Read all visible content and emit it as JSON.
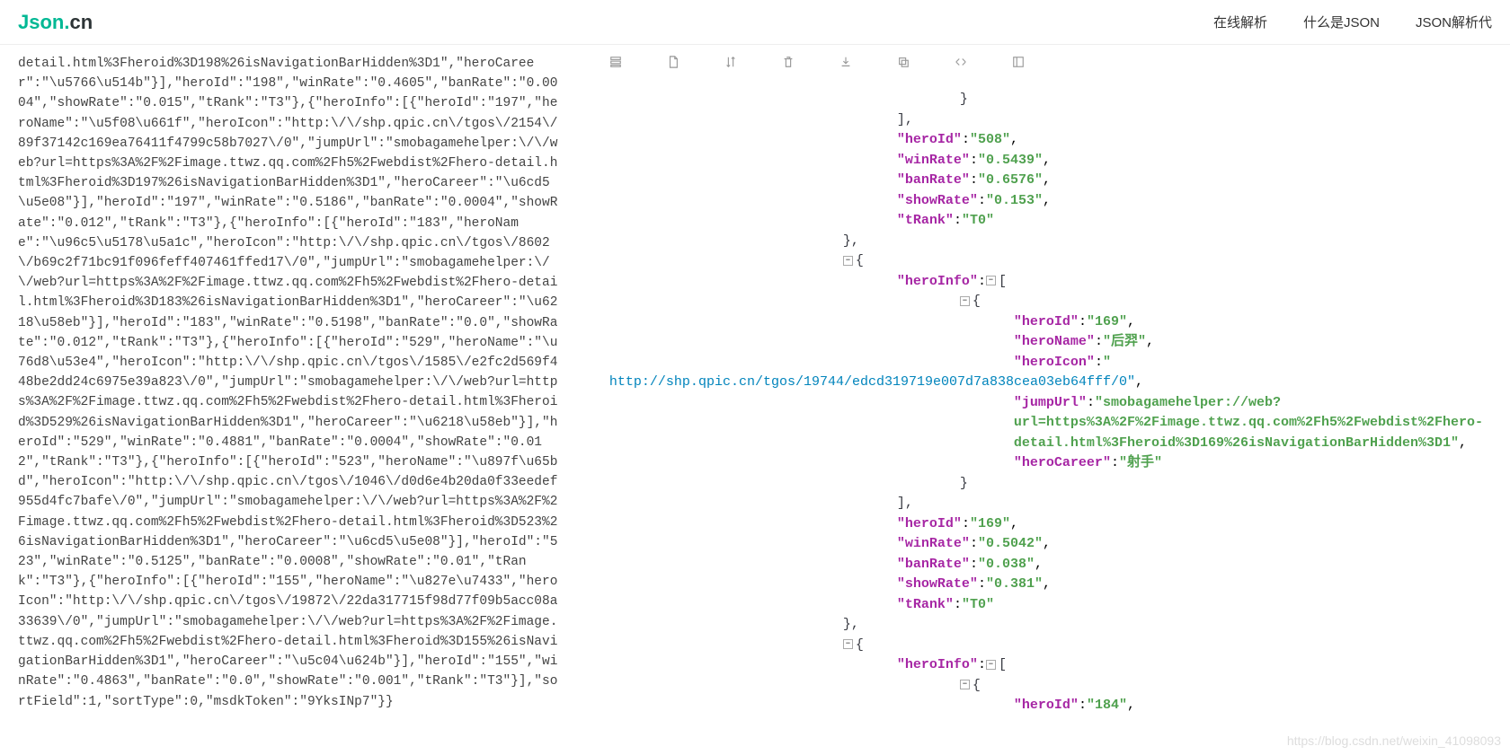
{
  "site": {
    "logo_left": "Json",
    "logo_dot": ".",
    "logo_right": "cn"
  },
  "nav": {
    "parse": "在线解析",
    "what": "什么是JSON",
    "code": "JSON解析代"
  },
  "toolbar_icons": {
    "i1": "stack-icon",
    "i2": "file-icon",
    "i3": "sort-icon",
    "i4": "trash-icon",
    "i5": "download-icon",
    "i6": "copy-icon",
    "i7": "compress-icon",
    "i8": "expand-icon"
  },
  "raw_text": "detail.html%3Fheroid%3D198%26isNavigationBarHidden%3D1\",\"heroCareer\":\"\\u5766\\u514b\"}],\"heroId\":\"198\",\"winRate\":\"0.4605\",\"banRate\":\"0.0004\",\"showRate\":\"0.015\",\"tRank\":\"T3\"},{\"heroInfo\":[{\"heroId\":\"197\",\"heroName\":\"\\u5f08\\u661f\",\"heroIcon\":\"http:\\/\\/shp.qpic.cn\\/tgos\\/2154\\/89f37142c169ea76411f4799c58b7027\\/0\",\"jumpUrl\":\"smobagamehelper:\\/\\/web?url=https%3A%2F%2Fimage.ttwz.qq.com%2Fh5%2Fwebdist%2Fhero-detail.html%3Fheroid%3D197%26isNavigationBarHidden%3D1\",\"heroCareer\":\"\\u6cd5\\u5e08\"}],\"heroId\":\"197\",\"winRate\":\"0.5186\",\"banRate\":\"0.0004\",\"showRate\":\"0.012\",\"tRank\":\"T3\"},{\"heroInfo\":[{\"heroId\":\"183\",\"heroName\":\"\\u96c5\\u5178\\u5a1c\",\"heroIcon\":\"http:\\/\\/shp.qpic.cn\\/tgos\\/8602\\/b69c2f71bc91f096feff407461ffed17\\/0\",\"jumpUrl\":\"smobagamehelper:\\/\\/web?url=https%3A%2F%2Fimage.ttwz.qq.com%2Fh5%2Fwebdist%2Fhero-detail.html%3Fheroid%3D183%26isNavigationBarHidden%3D1\",\"heroCareer\":\"\\u6218\\u58eb\"}],\"heroId\":\"183\",\"winRate\":\"0.5198\",\"banRate\":\"0.0\",\"showRate\":\"0.012\",\"tRank\":\"T3\"},{\"heroInfo\":[{\"heroId\":\"529\",\"heroName\":\"\\u76d8\\u53e4\",\"heroIcon\":\"http:\\/\\/shp.qpic.cn\\/tgos\\/1585\\/e2fc2d569f448be2dd24c6975e39a823\\/0\",\"jumpUrl\":\"smobagamehelper:\\/\\/web?url=https%3A%2F%2Fimage.ttwz.qq.com%2Fh5%2Fwebdist%2Fhero-detail.html%3Fheroid%3D529%26isNavigationBarHidden%3D1\",\"heroCareer\":\"\\u6218\\u58eb\"}],\"heroId\":\"529\",\"winRate\":\"0.4881\",\"banRate\":\"0.0004\",\"showRate\":\"0.012\",\"tRank\":\"T3\"},{\"heroInfo\":[{\"heroId\":\"523\",\"heroName\":\"\\u897f\\u65bd\",\"heroIcon\":\"http:\\/\\/shp.qpic.cn\\/tgos\\/1046\\/d0d6e4b20da0f33eedef955d4fc7bafe\\/0\",\"jumpUrl\":\"smobagamehelper:\\/\\/web?url=https%3A%2F%2Fimage.ttwz.qq.com%2Fh5%2Fwebdist%2Fhero-detail.html%3Fheroid%3D523%26isNavigationBarHidden%3D1\",\"heroCareer\":\"\\u6cd5\\u5e08\"}],\"heroId\":\"523\",\"winRate\":\"0.5125\",\"banRate\":\"0.0008\",\"showRate\":\"0.01\",\"tRank\":\"T3\"},{\"heroInfo\":[{\"heroId\":\"155\",\"heroName\":\"\\u827e\\u7433\",\"heroIcon\":\"http:\\/\\/shp.qpic.cn\\/tgos\\/19872\\/22da317715f98d77f09b5acc08a33639\\/0\",\"jumpUrl\":\"smobagamehelper:\\/\\/web?url=https%3A%2F%2Fimage.ttwz.qq.com%2Fh5%2Fwebdist%2Fhero-detail.html%3Fheroid%3D155%26isNavigationBarHidden%3D1\",\"heroCareer\":\"\\u5c04\\u624b\"}],\"heroId\":\"155\",\"winRate\":\"0.4863\",\"banRate\":\"0.0\",\"showRate\":\"0.001\",\"tRank\":\"T3\"}],\"sortField\":1,\"sortType\":0,\"msdkToken\":\"9YksINp7\"}}",
  "json": {
    "closing_brace": "}",
    "closing_bracket": "],",
    "heroId_508": "\"heroId\"",
    "heroId_508_v": "\"508\"",
    "winRate": "\"winRate\"",
    "winRate_508_v": "\"0.5439\"",
    "banRate": "\"banRate\"",
    "banRate_508_v": "\"0.6576\"",
    "showRate": "\"showRate\"",
    "showRate_508_v": "\"0.153\"",
    "tRank": "\"tRank\"",
    "tRank_T0": "\"T0\"",
    "close_curly": "},",
    "open_curly": "{",
    "heroInfo": "\"heroInfo\"",
    "open_bracket_curly": "[",
    "heroId": "\"heroId\"",
    "heroId_169_v": "\"169\"",
    "heroName": "\"heroName\"",
    "heroName_169_v": "\"后羿\"",
    "heroIcon": "\"heroIcon\"",
    "heroIcon_169_url": "http://shp.qpic.cn/tgos/19744/edcd319719e007d7a838cea03eb64fff/0\"",
    "jumpUrl": "\"jumpUrl\"",
    "jumpUrl_169_v": "\"smobagamehelper://web?url=https%3A%2F%2Fimage.ttwz.qq.com%2Fh5%2Fwebdist%2Fhero-detail.html%3Fheroid%3D169%26isNavigationBarHidden%3D1\"",
    "heroCareer": "\"heroCareer\"",
    "heroCareer_169_v": "\"射手\"",
    "winRate_169_v": "\"0.5042\"",
    "banRate_169_v": "\"0.038\"",
    "showRate_169_v": "\"0.381\"",
    "heroId_184_v": "\"184\""
  },
  "watermark": "https://blog.csdn.net/weixin_41098093"
}
